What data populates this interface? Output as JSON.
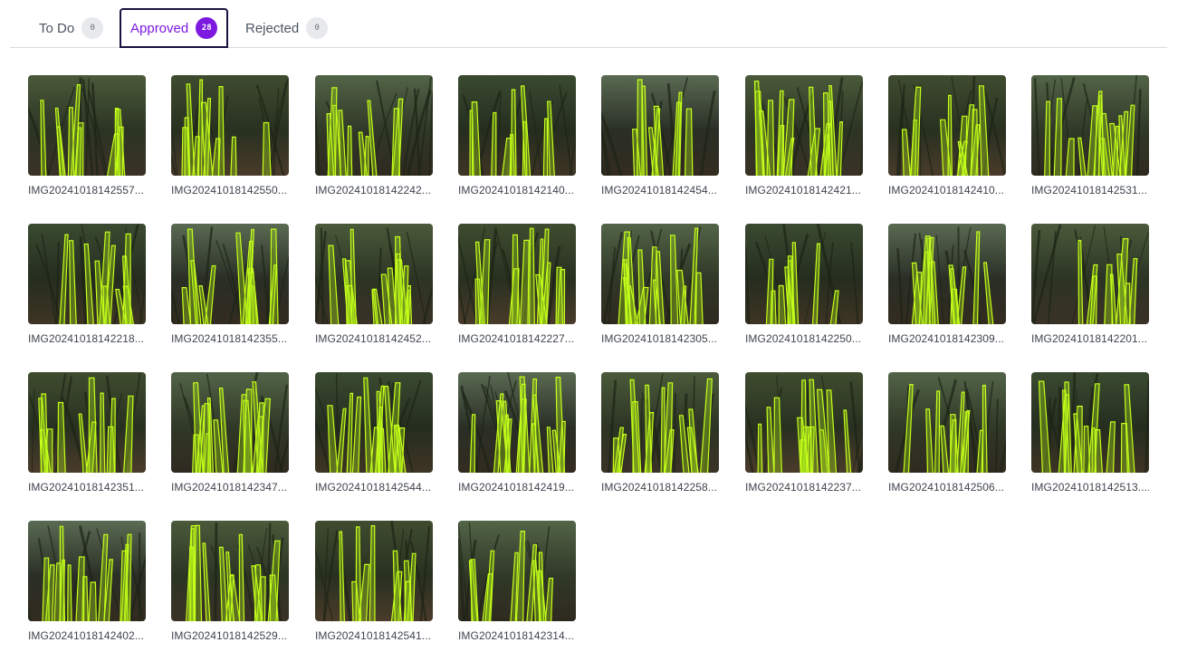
{
  "tabs": [
    {
      "label": "To Do",
      "count": "0",
      "active": false
    },
    {
      "label": "Approved",
      "count": "28",
      "active": true
    },
    {
      "label": "Rejected",
      "count": "0",
      "active": false
    }
  ],
  "colors": {
    "accent": "#7c18e0",
    "mask_outline": "#c6ff1a",
    "mask_fill": "#a8e81a"
  },
  "images": [
    {
      "name": "IMG20241018142557...",
      "image": "grass-photo-with-segmentation-mask"
    },
    {
      "name": "IMG20241018142550...",
      "image": "grass-photo-with-segmentation-mask"
    },
    {
      "name": "IMG20241018142242...",
      "image": "grass-photo-with-segmentation-mask"
    },
    {
      "name": "IMG20241018142140...",
      "image": "grass-photo-with-segmentation-mask"
    },
    {
      "name": "IMG20241018142454...",
      "image": "grass-photo-with-segmentation-mask"
    },
    {
      "name": "IMG20241018142421...",
      "image": "grass-photo-with-segmentation-mask"
    },
    {
      "name": "IMG20241018142410...",
      "image": "grass-photo-with-segmentation-mask"
    },
    {
      "name": "IMG20241018142531...",
      "image": "grass-photo-with-segmentation-mask"
    },
    {
      "name": "IMG20241018142218...",
      "image": "grass-photo-with-segmentation-mask"
    },
    {
      "name": "IMG20241018142355...",
      "image": "grass-photo-with-segmentation-mask"
    },
    {
      "name": "IMG20241018142452...",
      "image": "grass-photo-with-segmentation-mask"
    },
    {
      "name": "IMG20241018142227...",
      "image": "grass-photo-with-segmentation-mask"
    },
    {
      "name": "IMG20241018142305...",
      "image": "grass-photo-with-segmentation-mask"
    },
    {
      "name": "IMG20241018142250...",
      "image": "grass-photo-with-segmentation-mask"
    },
    {
      "name": "IMG20241018142309...",
      "image": "grass-photo-with-segmentation-mask"
    },
    {
      "name": "IMG20241018142201...",
      "image": "grass-photo-with-segmentation-mask"
    },
    {
      "name": "IMG20241018142351...",
      "image": "grass-photo-with-segmentation-mask"
    },
    {
      "name": "IMG20241018142347...",
      "image": "grass-photo-with-segmentation-mask"
    },
    {
      "name": "IMG20241018142544...",
      "image": "grass-photo-with-segmentation-mask"
    },
    {
      "name": "IMG20241018142419...",
      "image": "grass-photo-with-segmentation-mask"
    },
    {
      "name": "IMG20241018142258...",
      "image": "grass-photo-with-segmentation-mask"
    },
    {
      "name": "IMG20241018142237...",
      "image": "grass-photo-with-segmentation-mask"
    },
    {
      "name": "IMG20241018142506...",
      "image": "grass-photo-with-segmentation-mask"
    },
    {
      "name": "IMG20241018142513....",
      "image": "grass-photo-with-segmentation-mask"
    },
    {
      "name": "IMG20241018142402...",
      "image": "grass-photo-with-segmentation-mask"
    },
    {
      "name": "IMG20241018142529...",
      "image": "grass-photo-with-segmentation-mask"
    },
    {
      "name": "IMG20241018142541...",
      "image": "grass-photo-with-segmentation-mask"
    },
    {
      "name": "IMG20241018142314...",
      "image": "grass-photo-with-segmentation-mask"
    }
  ]
}
